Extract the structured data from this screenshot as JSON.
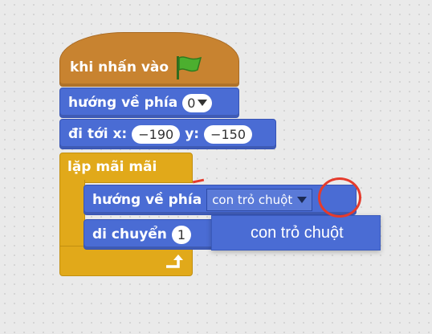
{
  "blocks": {
    "hat": {
      "label": "khi nhấn vào",
      "icon": "green-flag-icon"
    },
    "point_direction": {
      "label": "hướng về phía",
      "value": "0"
    },
    "goto_xy": {
      "label": "đi tới x:",
      "x_value": "−190",
      "y_label": "y:",
      "y_value": "−150"
    },
    "forever": {
      "label": "lặp mãi mãi",
      "icon": "loop-arrow-icon"
    },
    "point_towards": {
      "label": "hướng về phía",
      "value": "con trỏ chuột"
    },
    "move_steps": {
      "label": "di chuyển",
      "value": "1"
    }
  },
  "dropdown_menu": {
    "options": [
      "con trỏ chuột"
    ]
  },
  "colors": {
    "events": "#c88330",
    "motion": "#4a6cd4",
    "control": "#e1a91a",
    "highlight_circle": "#e53b2c",
    "flag": "#4caf2f"
  }
}
